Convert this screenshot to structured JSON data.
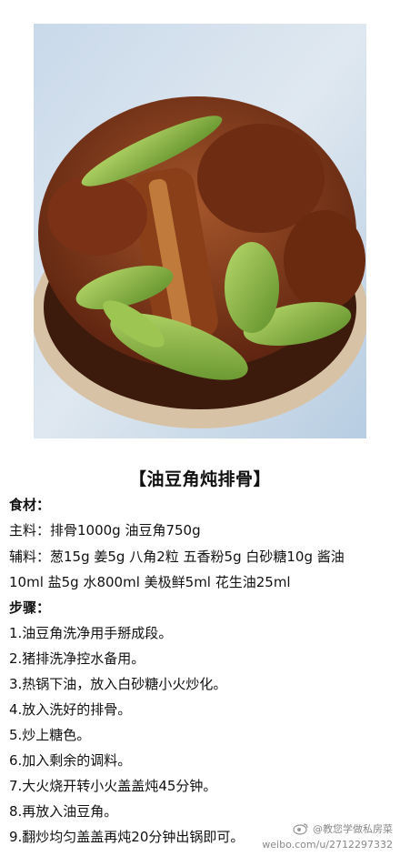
{
  "title": "【油豆角炖排骨】",
  "ingredients_header": "食材：",
  "main_ingredients": "主料：排骨1000g 油豆角750g",
  "aux_ingredients_line1": "辅料：葱15g 姜5g 八角2粒 五香粉5g 白砂糖10g 酱油",
  "aux_ingredients_line2": "10ml 盐5g 水800ml 美极鲜5ml 花生油25ml",
  "steps_header": "步骤：",
  "steps": [
    "1.油豆角洗净用手掰成段。",
    "2.猪排洗净控水备用。",
    "3.热锅下油，放入白砂糖小火炒化。",
    "4.放入洗好的排骨。",
    "5.炒上糖色。",
    "6.加入剩余的调料。",
    "7.大火烧开转小火盖盖炖45分钟。",
    "8.再放入油豆角。",
    "9.翻炒均匀盖盖再炖20分钟出锅即可。"
  ],
  "watermark": {
    "account": "@教您学做私房菜",
    "url": "weibo.com/u/2712297332"
  }
}
